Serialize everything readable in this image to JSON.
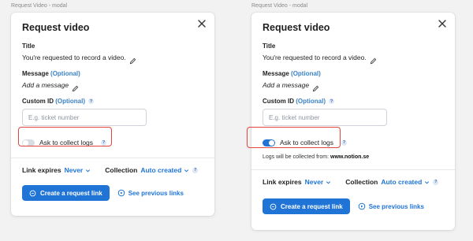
{
  "frames": [
    {
      "frame_label": "Request Video - modal",
      "title": "Request video",
      "title_label": "Title",
      "title_value": "You're requested to record a video.",
      "message_label": "Message",
      "message_optional": "(Optional)",
      "message_value": "Add a message",
      "custom_id_label": "Custom ID",
      "custom_id_optional": "(Optional)",
      "custom_id_placeholder": "E.g. ticket number",
      "toggle_label": "Ask to collect logs",
      "toggle_on": false,
      "logs_note_prefix": "",
      "logs_note_domain": "",
      "link_expires_label": "Link expires",
      "link_expires_value": "Never",
      "collection_label": "Collection",
      "collection_value": "Auto created",
      "primary_button": "Create a request link",
      "secondary_link": "See previous links"
    },
    {
      "frame_label": "Request Video - modal",
      "title": "Request video",
      "title_label": "Title",
      "title_value": "You're requested to record a video.",
      "message_label": "Message",
      "message_optional": "(Optional)",
      "message_value": "Add a message",
      "custom_id_label": "Custom ID",
      "custom_id_optional": "(Optional)",
      "custom_id_placeholder": "E.g. ticket number",
      "toggle_label": "Ask to collect logs",
      "toggle_on": true,
      "logs_note_prefix": "Logs will be collected from:",
      "logs_note_domain": "www.notion.se",
      "link_expires_label": "Link expires",
      "link_expires_value": "Never",
      "collection_label": "Collection",
      "collection_value": "Auto created",
      "primary_button": "Create a request link",
      "secondary_link": "See previous links"
    }
  ],
  "colors": {
    "accent": "#1f74d6",
    "highlight_outline": "#e0463d",
    "background": "#f2f2f2"
  },
  "icons": [
    "close-icon",
    "pencil-icon",
    "help-icon",
    "chevron-down-icon",
    "chat-bubble-icon",
    "video-history-icon"
  ]
}
